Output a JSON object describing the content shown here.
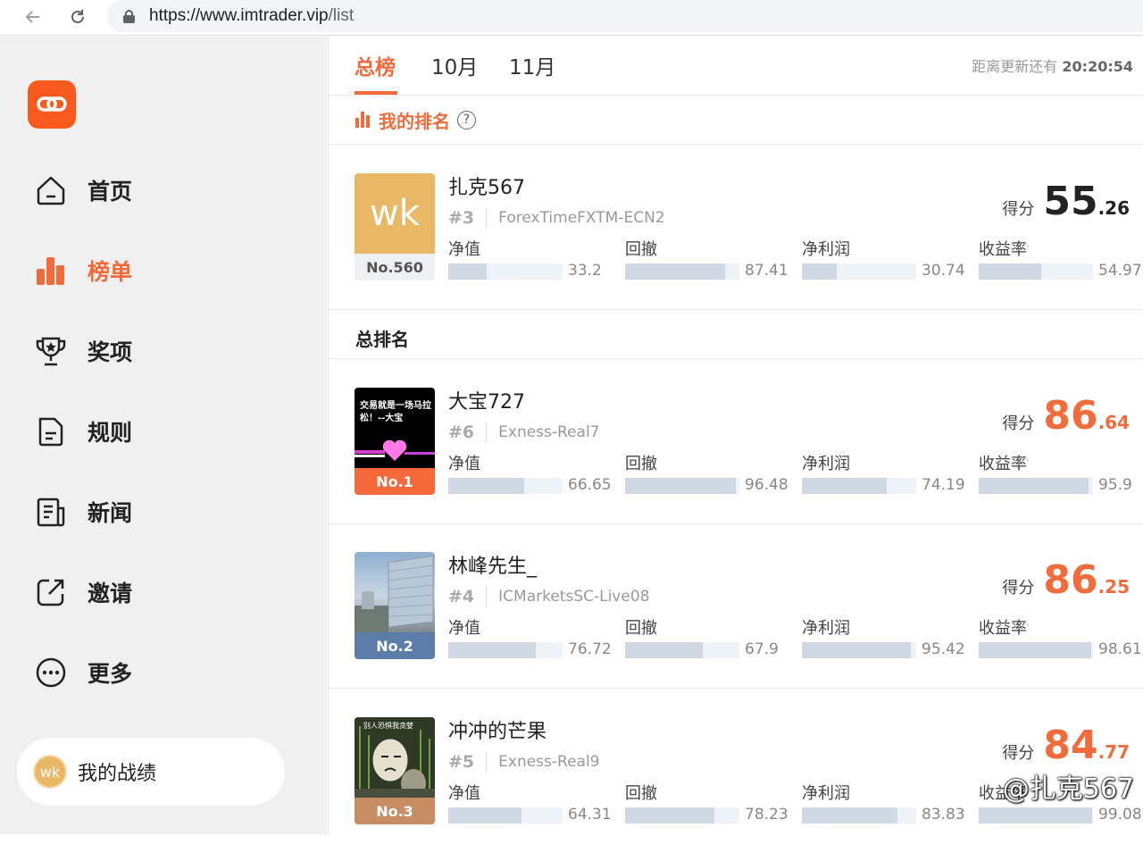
{
  "browser": {
    "url_host": "https://www.imtrader.vip",
    "url_path": "/list"
  },
  "sidebar": {
    "items": [
      {
        "label": "首页",
        "icon": "home-icon"
      },
      {
        "label": "榜单",
        "icon": "bar-chart-icon",
        "active": true
      },
      {
        "label": "奖项",
        "icon": "trophy-icon"
      },
      {
        "label": "规则",
        "icon": "document-icon"
      },
      {
        "label": "新闻",
        "icon": "news-icon"
      },
      {
        "label": "邀请",
        "icon": "share-icon"
      },
      {
        "label": "更多",
        "icon": "more-icon"
      }
    ],
    "my_performance": {
      "avatar": "wk",
      "label": "我的战绩"
    }
  },
  "tabs": [
    {
      "label": "总榜",
      "active": true
    },
    {
      "label": "10月"
    },
    {
      "label": "11月"
    }
  ],
  "countdown": {
    "label": "距离更新还有",
    "value": "20:20:54"
  },
  "my_rank": {
    "title": "我的排名",
    "entry": {
      "avatar": "wk",
      "badge": "No.560",
      "name": "扎克567",
      "rank": "#3",
      "server": "ForexTimeFXTM-ECN2",
      "score_label": "得分",
      "score_int": "55",
      "score_dec": ".26",
      "metrics": [
        {
          "name": "净值",
          "value": "33.2"
        },
        {
          "name": "回撤",
          "value": "87.41"
        },
        {
          "name": "净利润",
          "value": "30.74"
        },
        {
          "name": "收益率",
          "value": "54.97"
        }
      ]
    }
  },
  "overall": {
    "title": "总排名",
    "entries": [
      {
        "badge": "No.1",
        "badge_color": "#f5693a",
        "name": "大宝727",
        "rank": "#6",
        "server": "Exness-Real7",
        "avatar_text": "交易就是一场马拉松！--大宝",
        "score_label": "得分",
        "score_int": "86",
        "score_dec": ".64",
        "metrics": [
          {
            "name": "净值",
            "value": "66.65"
          },
          {
            "name": "回撤",
            "value": "96.48"
          },
          {
            "name": "净利润",
            "value": "74.19"
          },
          {
            "name": "收益率",
            "value": "95.9"
          }
        ]
      },
      {
        "badge": "No.2",
        "badge_color": "#5b7da8",
        "name": "林峰先生_",
        "rank": "#4",
        "server": "ICMarketsSC-Live08",
        "score_label": "得分",
        "score_int": "86",
        "score_dec": ".25",
        "metrics": [
          {
            "name": "净值",
            "value": "76.72"
          },
          {
            "name": "回撤",
            "value": "67.9"
          },
          {
            "name": "净利润",
            "value": "95.42"
          },
          {
            "name": "收益率",
            "value": "98.61"
          }
        ]
      },
      {
        "badge": "No.3",
        "badge_color": "#c98d64",
        "name": "冲冲的芒果",
        "rank": "#5",
        "server": "Exness-Real9",
        "avatar_text": "别人恐惧我贪婪",
        "score_label": "得分",
        "score_int": "84",
        "score_dec": ".77",
        "metrics": [
          {
            "name": "净值",
            "value": "64.31"
          },
          {
            "name": "回撤",
            "value": "78.23"
          },
          {
            "name": "净利润",
            "value": "83.83"
          },
          {
            "name": "收益率",
            "value": "99.08"
          }
        ]
      }
    ]
  },
  "watermark": "@扎克567",
  "colors": {
    "accent": "#f26b3a",
    "sidebar_bg": "#f0f0f0",
    "bar_bg": "#eef3fa",
    "bar_fill": "#d0d8e3"
  }
}
